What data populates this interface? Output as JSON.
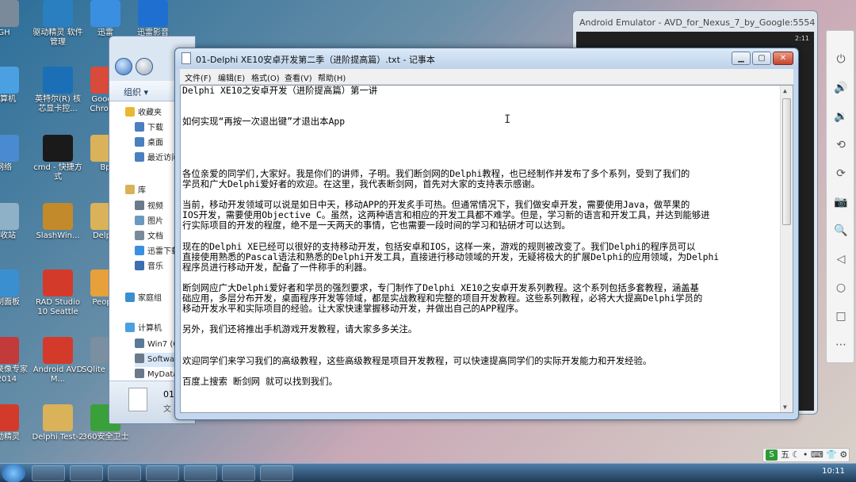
{
  "desktop_icons": [
    {
      "label": "GH",
      "color": "#7a8a9a"
    },
    {
      "label": "驱动精灵 软件管理",
      "color": "#2a7fc0"
    },
    {
      "label": "迅雷",
      "color": "#3a8fe0"
    },
    {
      "label": "迅雷影音",
      "color": "#1e6fd0"
    },
    {
      "label": "计算机",
      "color": "#4aa0e0"
    },
    {
      "label": "英特尔(R) 核芯显卡控...",
      "color": "#1a6fb6"
    },
    {
      "label": "Google Chrome",
      "color": "#d84a3a"
    },
    {
      "label": "网络",
      "color": "#4a8ad0"
    },
    {
      "label": "cmd - 快捷方式",
      "color": "#1a1a1a"
    },
    {
      "label": "Bp",
      "color": "#d9b25a"
    },
    {
      "label": "回收站",
      "color": "#8fb1c8"
    },
    {
      "label": "SlashWin...",
      "color": "#c28a2a"
    },
    {
      "label": "Delphi",
      "color": "#d9b25a"
    },
    {
      "label": "控制面板",
      "color": "#3a8fd0"
    },
    {
      "label": "RAD Studio 10 Seattle",
      "color": "#d43a2a"
    },
    {
      "label": "People",
      "color": "#e8a03a"
    },
    {
      "label": "屏幕录像专家V2014",
      "color": "#c23a3a"
    },
    {
      "label": "Android AVD M...",
      "color": "#d43a2a"
    },
    {
      "label": "SQlite - 快捷",
      "color": "#7a8fa0"
    },
    {
      "label": "驱动精灵",
      "color": "#d43a2a"
    },
    {
      "label": "Delphi Test-2",
      "color": "#d9b25a"
    },
    {
      "label": "360安全卫士",
      "color": "#3aa03a"
    }
  ],
  "explorer": {
    "organize_label": "组织 ▾",
    "tree": [
      {
        "label": "收藏夹",
        "color": "#e8b830"
      },
      {
        "label": "下载",
        "color": "#4a7fc0"
      },
      {
        "label": "桌面",
        "color": "#4a7fc0"
      },
      {
        "label": "最近访问",
        "color": "#4a7fc0"
      },
      {
        "label": "库",
        "color": "#d9b25a"
      },
      {
        "label": "视频",
        "color": "#6a7a8a"
      },
      {
        "label": "图片",
        "color": "#6a9ac0"
      },
      {
        "label": "文档",
        "color": "#7a8a9a"
      },
      {
        "label": "迅雷下载",
        "color": "#3a8fe0"
      },
      {
        "label": "音乐",
        "color": "#3a6fb0"
      },
      {
        "label": "家庭组",
        "color": "#3a8fd0"
      },
      {
        "label": "计算机",
        "color": "#4aa0e0"
      },
      {
        "label": "Win7 (C",
        "color": "#5a7a9a"
      },
      {
        "label": "Softwar",
        "color": "#6a7a8a"
      },
      {
        "label": "MyData",
        "color": "#6a7a8a"
      },
      {
        "label": "Virtual",
        "color": "#6a7a8a"
      }
    ],
    "status_file": "01",
    "status_type": "文"
  },
  "emulator": {
    "title": "Android Emulator - AVD_for_Nexus_7_by_Google:5554",
    "status_time": "2:11"
  },
  "emulator_controls": [
    {
      "icon": "power-icon",
      "glyph": "⏻"
    },
    {
      "icon": "volume-up-icon",
      "glyph": "🔊"
    },
    {
      "icon": "volume-down-icon",
      "glyph": "🔉"
    },
    {
      "icon": "rotate-left-icon",
      "glyph": "⟲"
    },
    {
      "icon": "rotate-right-icon",
      "glyph": "⟳"
    },
    {
      "icon": "camera-icon",
      "glyph": "📷"
    },
    {
      "icon": "zoom-icon",
      "glyph": "🔍"
    },
    {
      "icon": "back-icon",
      "glyph": "◁"
    },
    {
      "icon": "home-icon",
      "glyph": "○"
    },
    {
      "icon": "overview-icon",
      "glyph": "□"
    },
    {
      "icon": "more-icon",
      "glyph": "⋯"
    }
  ],
  "notepad": {
    "title": "01-Delphi XE10安卓开发第二季（进阶提高篇）.txt - 记事本",
    "min_glyph": "▁",
    "max_glyph": "▢",
    "close_glyph": "✕",
    "menu": [
      "文件(F)",
      "编辑(E)",
      "格式(O)",
      "查看(V)",
      "帮助(H)"
    ],
    "lines": [
      "Delphi XE10之安卓开发（进阶提高篇）第一讲",
      "",
      "",
      "                         如何实现“再按一次退出键”才退出本App",
      "",
      "",
      "",
      "",
      "    各位亲爱的同学们,大家好。我是你们的讲师，子明。我们断剑网的Delphi教程，也已经制作并发布了多个系列，受到了我们的",
      "学员和广大Delphi爱好者的欢迎。在这里，我代表断剑网，首先对大家的支持表示感谢。",
      "",
      "    当前，移动开发领域可以说是如日中天，移动APP的开发炙手可热。但通常情况下，我们做安卓开发，需要使用Java，做苹果的",
      "IOS开发，需要使用Objective C。虽然，这两种语言和相应的开发工具都不难学。但是，学习新的语言和开发工具，并达到能够进",
      "行实际项目的开发的程度，绝不是一天两天的事情，它也需要一段时间的学习和钻研才可以达到。",
      "",
      "    现在的Delphi XE已经可以很好的支持移动开发，包括安卓和IOS，这样一来，游戏的规则被改变了。我们Delphi的程序员可以",
      "直接使用熟悉的Pascal语法和熟悉的Delphi开发工具，直接进行移动领域的开发，无疑将极大的扩展Delphi的应用领域，为Delphi",
      "程序员进行移动开发，配备了一件称手的利器。",
      "",
      "    断剑网应广大Delphi爱好者和学员的强烈要求，专门制作了Delphi XE10之安卓开发系列教程。这个系列包括多套教程，涵盖基",
      "础应用，多层分布开发，桌面程序开发等领域，都是实战教程和完整的项目开发教程。这些系列教程，必将大大提高Delphi学员的",
      "移动开发水平和实际项目的经验。让大家快速掌握移动开发，并做出自己的APP程序。",
      "",
      "    另外，我们还将推出手机游戏开发教程，请大家多多关注。",
      "",
      "",
      "    欢迎同学们来学习我们的高级教程，这些高级教程是项目开发教程，可以快速提高同学们的实际开发能力和开发经验。",
      "",
      "    百度上搜索 断剑网 就可以找到我们。"
    ]
  },
  "taskbar": {
    "time": "10:11",
    "ime_logo": "S",
    "ime_text": "五 ☾ • ⌨ 👕 ⚙"
  }
}
